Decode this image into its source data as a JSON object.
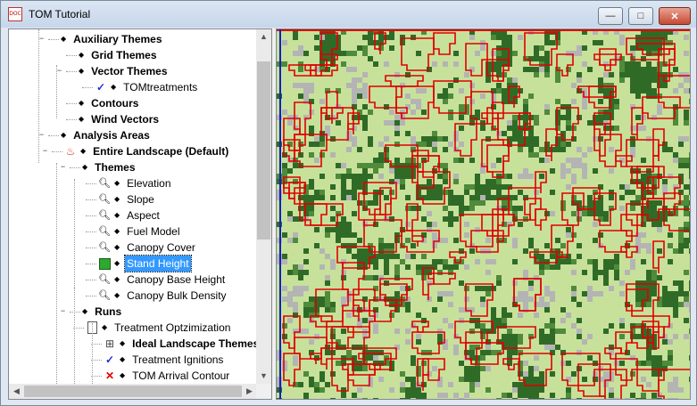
{
  "window": {
    "title": "TOM Tutorial",
    "icon": "document-icon"
  },
  "controls": {
    "minimize": "—",
    "maximize": "□",
    "close": "✕"
  },
  "tree": {
    "rows": [
      {
        "name": "tree-item-auxiliary-themes",
        "label": "Auxiliary Themes",
        "bold": true
      },
      {
        "name": "tree-item-grid-themes",
        "label": "Grid Themes",
        "bold": true
      },
      {
        "name": "tree-item-vector-themes",
        "label": "Vector Themes",
        "bold": true
      },
      {
        "name": "tree-item-tomtreatments",
        "label": "TOMtreatments",
        "bold": false,
        "icon": "checkmark-icon"
      },
      {
        "name": "tree-item-contours",
        "label": "Contours",
        "bold": true
      },
      {
        "name": "tree-item-wind-vectors",
        "label": "Wind Vectors",
        "bold": true
      },
      {
        "name": "tree-item-analysis-areas",
        "label": "Analysis Areas",
        "bold": true
      },
      {
        "name": "tree-item-entire-landscape",
        "label": "Entire Landscape (Default)",
        "bold": true,
        "icon": "fire-icon"
      },
      {
        "name": "tree-item-themes",
        "label": "Themes",
        "bold": true
      },
      {
        "name": "tree-item-elevation",
        "label": "Elevation",
        "bold": false,
        "icon": "magnifier-icon"
      },
      {
        "name": "tree-item-slope",
        "label": "Slope",
        "bold": false,
        "icon": "magnifier-icon"
      },
      {
        "name": "tree-item-aspect",
        "label": "Aspect",
        "bold": false,
        "icon": "magnifier-icon"
      },
      {
        "name": "tree-item-fuel-model",
        "label": "Fuel Model",
        "bold": false,
        "icon": "magnifier-icon"
      },
      {
        "name": "tree-item-canopy-cover",
        "label": "Canopy Cover",
        "bold": false,
        "icon": "magnifier-icon"
      },
      {
        "name": "tree-item-stand-height",
        "label": "Stand Height",
        "bold": false,
        "icon": "green-square-icon",
        "selected": true
      },
      {
        "name": "tree-item-canopy-base-height",
        "label": "Canopy Base Height",
        "bold": false,
        "icon": "magnifier-icon"
      },
      {
        "name": "tree-item-canopy-bulk-density",
        "label": "Canopy Bulk Density",
        "bold": false,
        "icon": "magnifier-icon"
      },
      {
        "name": "tree-item-runs",
        "label": "Runs",
        "bold": true
      },
      {
        "name": "tree-item-treatment-optimization",
        "label": "Treatment Optzimization",
        "bold": false,
        "icon": "page-icon"
      },
      {
        "name": "tree-item-ideal-landscape-themes",
        "label": "Ideal Landscape Themes",
        "bold": true,
        "icon": "grid-plus-icon"
      },
      {
        "name": "tree-item-treatment-ignitions",
        "label": "Treatment Ignitions",
        "bold": false,
        "icon": "checkmark-icon"
      },
      {
        "name": "tree-item-tom-arrival-contour",
        "label": "TOM Arrival Contour",
        "bold": false,
        "icon": "red-x-icon"
      }
    ]
  },
  "map": {
    "colors": {
      "grass": "#c7e19b",
      "forest": "#2f6b27",
      "forest_light": "#4f8b3a",
      "rock": "#b4b4b4",
      "treatment_outline": "#e00000",
      "left_boundary": "#1020c0"
    }
  }
}
